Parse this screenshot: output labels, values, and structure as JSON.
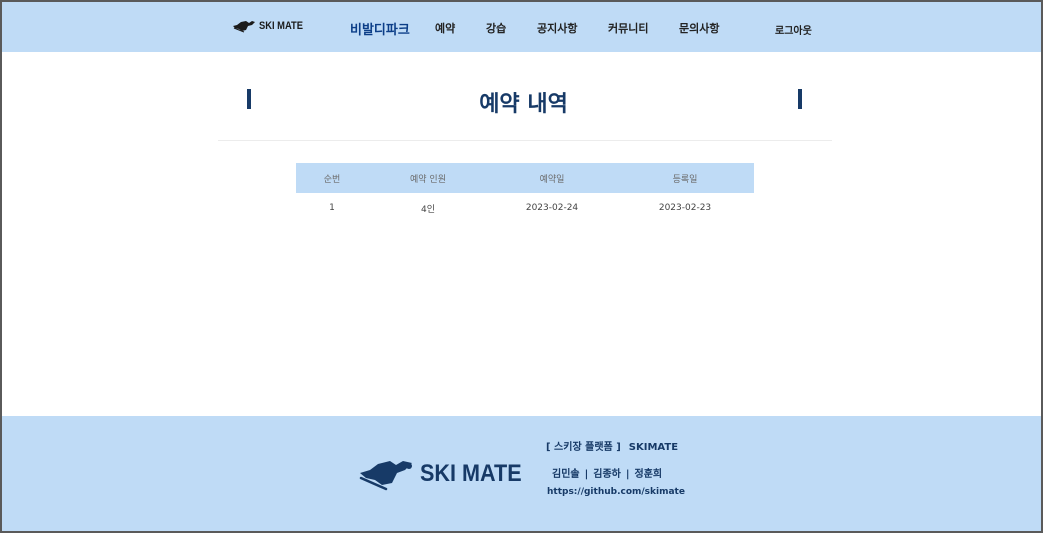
{
  "header": {
    "logo_text": "SKI MATE",
    "brand_link": "비발디파크",
    "nav": [
      "예약",
      "강습",
      "공지사항",
      "커뮤니티",
      "문의사항"
    ],
    "logout": "로그아웃"
  },
  "page": {
    "title": "예약 내역"
  },
  "table": {
    "headers": [
      "순번",
      "예약 인원",
      "예약일",
      "등록일"
    ],
    "rows": [
      [
        "1",
        "4인",
        "2023-02-24",
        "2023-02-23"
      ]
    ]
  },
  "footer": {
    "logo_text": "SKI MATE",
    "platform_label": "[ 스키장 플랫폼 ]",
    "platform_brand": "SKIMATE",
    "members": [
      "김민솔",
      "김종하",
      "정훈희"
    ],
    "separator": "|",
    "link": "https://github.com/skimate"
  },
  "colors": {
    "header_bg": "#bfdbf6",
    "accent": "#173a67",
    "brand_link": "#0c3e88"
  }
}
